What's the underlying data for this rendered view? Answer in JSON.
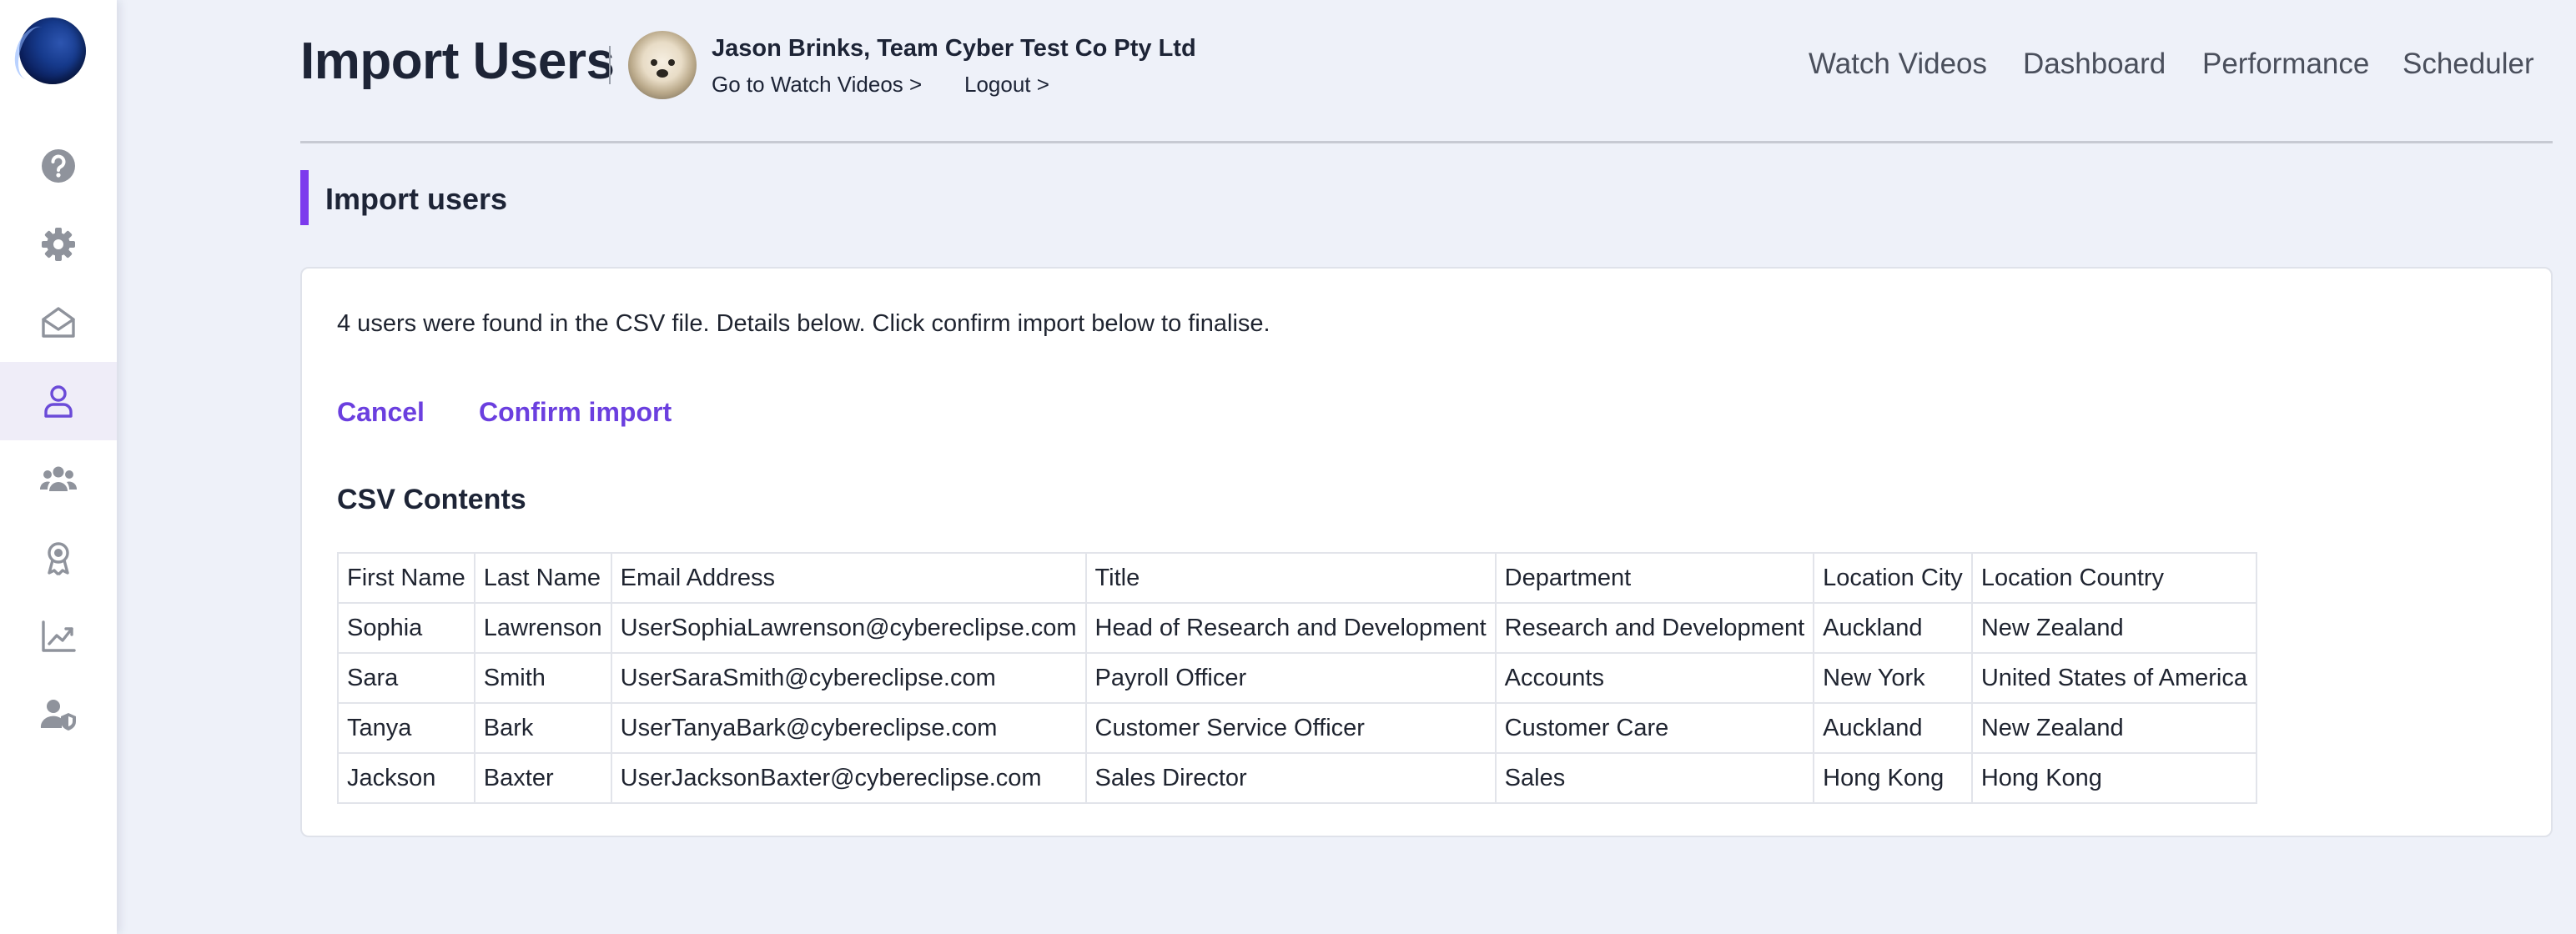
{
  "header": {
    "title": "Import Users",
    "user_name": "Jason Brinks, Team Cyber Test Co Pty Ltd",
    "watch_videos_link": "Go to Watch Videos >",
    "logout_link": "Logout >",
    "nav": {
      "watch_videos": "Watch Videos",
      "dashboard": "Dashboard",
      "performance": "Performance",
      "scheduler": "Scheduler"
    }
  },
  "sidebar": {
    "items": [
      {
        "icon": "help-icon"
      },
      {
        "icon": "gear-icon"
      },
      {
        "icon": "mail-icon"
      },
      {
        "icon": "user-icon",
        "active": true
      },
      {
        "icon": "group-icon"
      },
      {
        "icon": "award-icon"
      },
      {
        "icon": "chart-icon"
      },
      {
        "icon": "user-shield-icon"
      }
    ]
  },
  "section": {
    "title": "Import users"
  },
  "card": {
    "info_text": "4 users were found in the CSV file. Details below. Click confirm import below to finalise.",
    "cancel_label": "Cancel",
    "confirm_label": "Confirm import",
    "csv_title": "CSV Contents"
  },
  "table": {
    "headers": [
      "First Name",
      "Last Name",
      "Email Address",
      "Title",
      "Department",
      "Location City",
      "Location Country"
    ],
    "rows": [
      [
        "Sophia",
        "Lawrenson",
        "UserSophiaLawrenson@cybereclipse.com",
        "Head of Research and Development",
        "Research and Development",
        "Auckland",
        "New Zealand"
      ],
      [
        "Sara",
        "Smith",
        "UserSaraSmith@cybereclipse.com",
        "Payroll Officer",
        "Accounts",
        "New York",
        "United States of America"
      ],
      [
        "Tanya",
        "Bark",
        "UserTanyaBark@cybereclipse.com",
        "Customer Service Officer",
        "Customer Care",
        "Auckland",
        "New Zealand"
      ],
      [
        "Jackson",
        "Baxter",
        "UserJacksonBaxter@cybereclipse.com",
        "Sales Director",
        "Sales",
        "Hong Kong",
        "Hong Kong"
      ]
    ]
  },
  "colors": {
    "accent": "#7c3aed",
    "link": "#6b3fdf",
    "background": "#eef1f9"
  }
}
